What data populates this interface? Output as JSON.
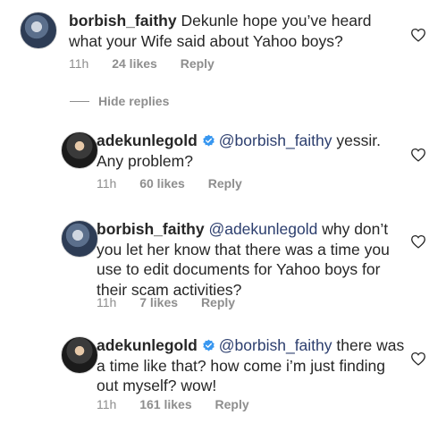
{
  "comments": [
    {
      "username": "borbish_faithy",
      "verified": false,
      "mention": "",
      "text": "Dekunle hope you’ve heard what your Wife said about Yahoo boys?",
      "time": "11h",
      "likes": "24 likes",
      "reply": "Reply"
    },
    {
      "username": "adekunlegold",
      "verified": true,
      "mention": "@borbish_faithy",
      "text": "yessir. Any problem?",
      "time": "11h",
      "likes": "60 likes",
      "reply": "Reply"
    },
    {
      "username": "borbish_faithy",
      "verified": false,
      "mention": "@adekunlegold",
      "text": "why don’t you let her know that there was a time you use to edit documents for Yahoo boys for their scam activities?",
      "time": "11h",
      "likes": "7 likes",
      "reply": "Reply"
    },
    {
      "username": "adekunlegold",
      "verified": true,
      "mention": "@borbish_faithy",
      "text": "there was a time like that? how come i’m just finding out myself? wow!",
      "time": "11h",
      "likes": "161 likes",
      "reply": "Reply"
    }
  ],
  "hide_replies": "Hide replies",
  "colors": {
    "verified": "#3897f0",
    "meta": "#8e8e8e",
    "mention": "#2c3e6e"
  },
  "icons": {
    "like": "heart-outline-icon",
    "verified": "verified-badge-icon"
  }
}
